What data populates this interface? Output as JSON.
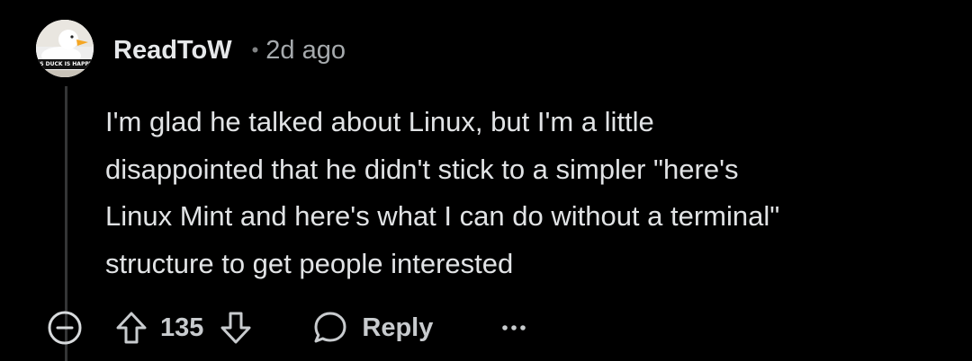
{
  "comment": {
    "author": {
      "username": "ReadToW",
      "avatar_banner_text": "IS DUCK IS HAPPY"
    },
    "separator": "•",
    "timestamp": "2d ago",
    "body": [
      "I'm glad he talked about Linux, but I'm a little",
      "disappointed that he didn't stick to a simpler \"here's",
      "Linux Mint and here's what I can do without a terminal\"",
      "structure to get people interested"
    ],
    "score": "135",
    "actions": {
      "reply_label": "Reply",
      "icons": {
        "collapse": "collapse-circle-minus-icon",
        "upvote": "arrow-up-icon",
        "downvote": "arrow-down-icon",
        "reply": "speech-bubble-icon",
        "more": "more-horizontal-icon"
      }
    }
  },
  "colors": {
    "background": "#000000",
    "text": "#e1e3e5",
    "muted": "#a6aaad",
    "thread_line": "#343536"
  }
}
